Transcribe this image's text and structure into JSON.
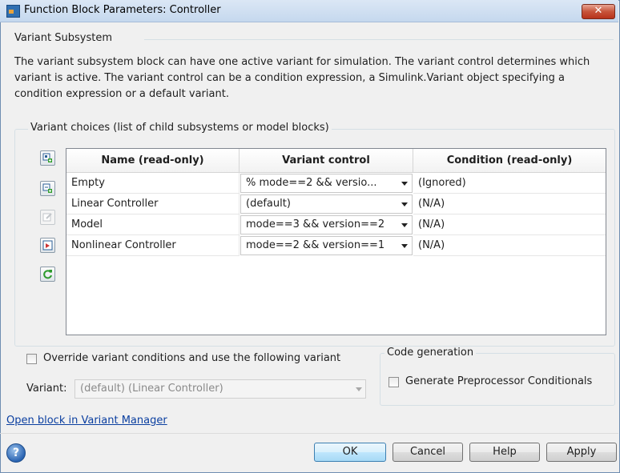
{
  "window": {
    "title": "Function Block Parameters: Controller",
    "close_glyph": "✕"
  },
  "group": {
    "title": "Variant Subsystem"
  },
  "description": "The variant subsystem block can have one active variant for simulation. The variant control determines which variant is active. The variant control can be a condition expression, a Simulink.Variant object specifying a condition expression or a default variant.",
  "choices": {
    "legend": "Variant choices (list of child subsystems or model blocks)",
    "toolbar_icons": [
      "add-subsystem-icon",
      "add-model-block-icon",
      "edit-icon",
      "open-block-icon",
      "refresh-icon"
    ],
    "columns": [
      "Name (read-only)",
      "Variant control",
      "Condition (read-only)"
    ],
    "rows": [
      {
        "name": "Empty",
        "control": "% mode==2 && versio...",
        "condition": "(Ignored)"
      },
      {
        "name": "Linear Controller",
        "control": "(default)",
        "condition": "(N/A)"
      },
      {
        "name": "Model",
        "control": "mode==3 && version==2",
        "condition": "(N/A)"
      },
      {
        "name": "Nonlinear Controller",
        "control": "mode==2 && version==1",
        "condition": "(N/A)"
      }
    ]
  },
  "override": {
    "label": "Override variant conditions and use the following variant",
    "checked": false
  },
  "variant": {
    "label": "Variant:",
    "value": "(default) (Linear Controller)"
  },
  "codegen": {
    "legend": "Code generation",
    "checkbox_label": "Generate Preprocessor Conditionals",
    "checked": false
  },
  "link": "Open block in Variant Manager",
  "buttons": {
    "ok": "OK",
    "cancel": "Cancel",
    "help": "Help",
    "apply": "Apply"
  },
  "help_glyph": "?"
}
